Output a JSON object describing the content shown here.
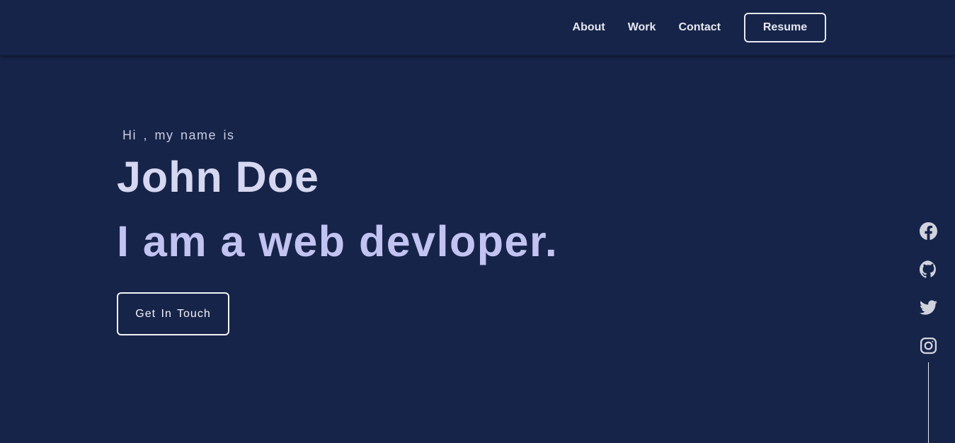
{
  "nav": {
    "links": [
      "About",
      "Work",
      "Contact"
    ],
    "resume_label": "Resume"
  },
  "hero": {
    "greeting": "Hi , my name is",
    "name": "John Doe",
    "tagline": "I am a web devloper.",
    "cta_label": "Get In Touch"
  },
  "social": {
    "icons": [
      "facebook-icon",
      "github-icon",
      "twitter-icon",
      "instagram-icon"
    ]
  },
  "colors": {
    "background": "#172449",
    "name_text": "#d6d7f0",
    "tagline_text": "#c2c3f1",
    "nav_text": "#e6e8f2",
    "icon": "#d0d2de"
  }
}
